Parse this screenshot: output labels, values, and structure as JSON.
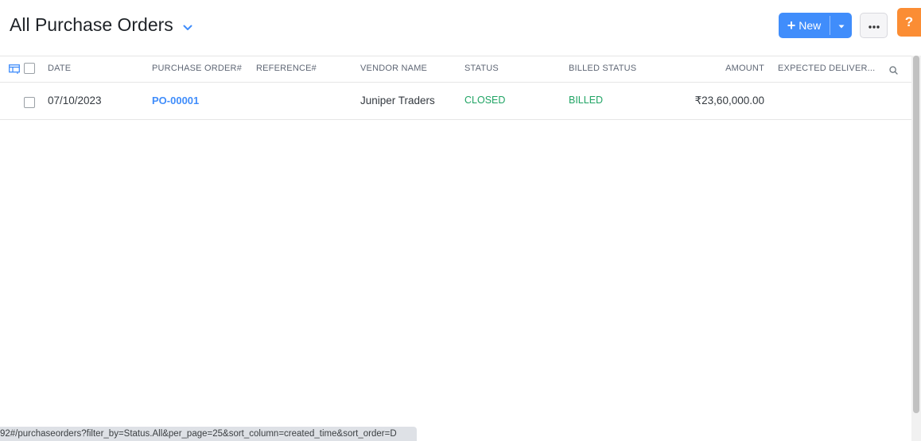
{
  "header": {
    "title": "All Purchase Orders",
    "new_label": "New",
    "help_label": "?"
  },
  "table": {
    "columns": [
      "DATE",
      "PURCHASE ORDER#",
      "REFERENCE#",
      "VENDOR NAME",
      "STATUS",
      "BILLED STATUS",
      "AMOUNT",
      "EXPECTED DELIVER..."
    ],
    "rows": [
      {
        "date": "07/10/2023",
        "purchase_order": "PO-00001",
        "reference": "",
        "vendor_name": "Juniper Traders",
        "status": "CLOSED",
        "billed_status": "BILLED",
        "amount": "₹23,60,000.00",
        "expected_delivery": ""
      }
    ]
  },
  "colors": {
    "accent": "#408dfb",
    "help": "#fb8d34",
    "status_green": "#20a464"
  },
  "icons": {
    "title_dropdown": "chevron-down-icon",
    "new_plus": "plus-icon",
    "new_caret": "caret-down-icon",
    "more": "ellipsis-icon",
    "columns": "column-config-icon",
    "search": "search-icon"
  },
  "status_bar": {
    "url": "92#/purchaseorders?filter_by=Status.All&per_page=25&sort_column=created_time&sort_order=D"
  }
}
